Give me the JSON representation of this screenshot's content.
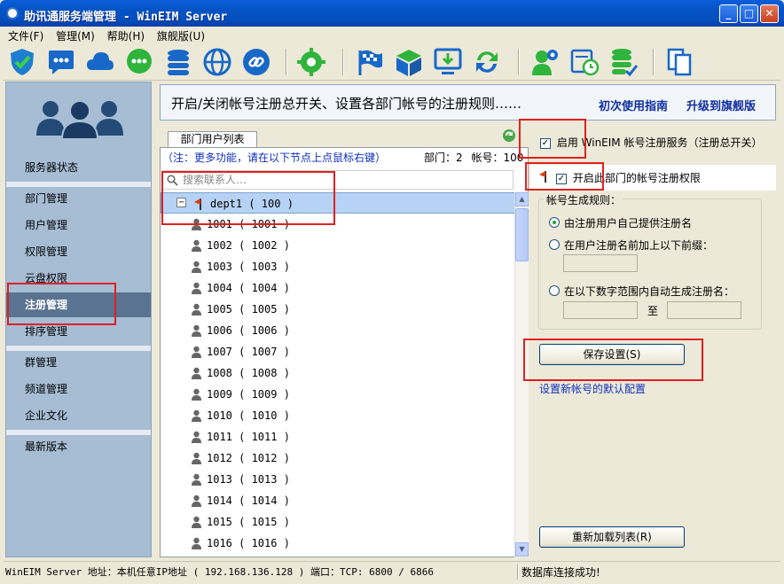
{
  "window": {
    "title": "助讯通服务端管理 - WinEIM Server",
    "minimize_label": "_",
    "maximize_label": "□",
    "close_label": "✕"
  },
  "menu": {
    "items": [
      "文件(F)",
      "管理(M)",
      "帮助(H)",
      "旗舰版(U)"
    ]
  },
  "toolbar": {
    "icons": [
      "shield-icon",
      "chat-icon",
      "cloud-icon",
      "message-icon",
      "database-icon",
      "globe-icon",
      "link-icon",
      "gear-icon",
      "flag-icon",
      "box-icon",
      "download-icon",
      "refresh-icon",
      "user-settings-icon",
      "calendar-icon",
      "database-check-icon",
      "copy-icon"
    ]
  },
  "sidebar": {
    "items": [
      "服务器状态",
      "部门管理",
      "用户管理",
      "权限管理",
      "云盘权限",
      "注册管理",
      "排序管理",
      "群管理",
      "频道管理",
      "企业文化",
      "最新版本"
    ],
    "active": "注册管理"
  },
  "header": {
    "description": "开启/关闭帐号注册总开关、设置各部门帐号的注册规则……",
    "guide_link": "初次使用指南",
    "upgrade_link": "升级到旗舰版"
  },
  "tree_panel": {
    "tab_label": "部门用户列表",
    "note": "（注：更多功能，请在以下节点上点鼠标右键）",
    "dept_count": "部门：2",
    "account_count": "帐号：100",
    "search_placeholder": "搜索联系人…",
    "root": {
      "expander": "−",
      "label": "dept1 ( 100 )"
    },
    "users": [
      "1001 ( 1001 )",
      "1002 ( 1002 )",
      "1003 ( 1003 )",
      "1004 ( 1004 )",
      "1005 ( 1005 )",
      "1006 ( 1006 )",
      "1007 ( 1007 )",
      "1008 ( 1008 )",
      "1009 ( 1009 )",
      "1010 ( 1010 )",
      "1011 ( 1011 )",
      "1012 ( 1012 )",
      "1013 ( 1013 )",
      "1014 ( 1014 )",
      "1015 ( 1015 )",
      "1016 ( 1016 )"
    ]
  },
  "right_panel": {
    "enable_service": {
      "label": "启用 WinEIM 帐号注册服务（注册总开关）",
      "checked": "✓"
    },
    "enable_dept": {
      "label": "开启此部门的帐号注册权限",
      "checked": "✓"
    },
    "rule_group_title": "帐号生成规则：",
    "rules": [
      "由注册用户自己提供注册名",
      "在用户注册名前加上以下前缀：",
      "在以下数字范围内自动生成注册名："
    ],
    "selected_rule": 0,
    "range_separator": "至",
    "save_button": "保存设置(S)",
    "default_config_link": "设置新帐号的默认配置",
    "reload_button": "重新加载列表(R)"
  },
  "status": {
    "left": "WinEIM Server 地址：本机任意IP地址 ( 192.168.136.128 )   端口：TCP: 6800 / 6866",
    "right": "数据库连接成功!"
  },
  "colors": {
    "titlebar": "#0453c4",
    "sidebar_bg": "#a6bdd4",
    "sidebar_active": "#5a7390",
    "link": "#1030a0",
    "highlight_box": "#e02020"
  }
}
